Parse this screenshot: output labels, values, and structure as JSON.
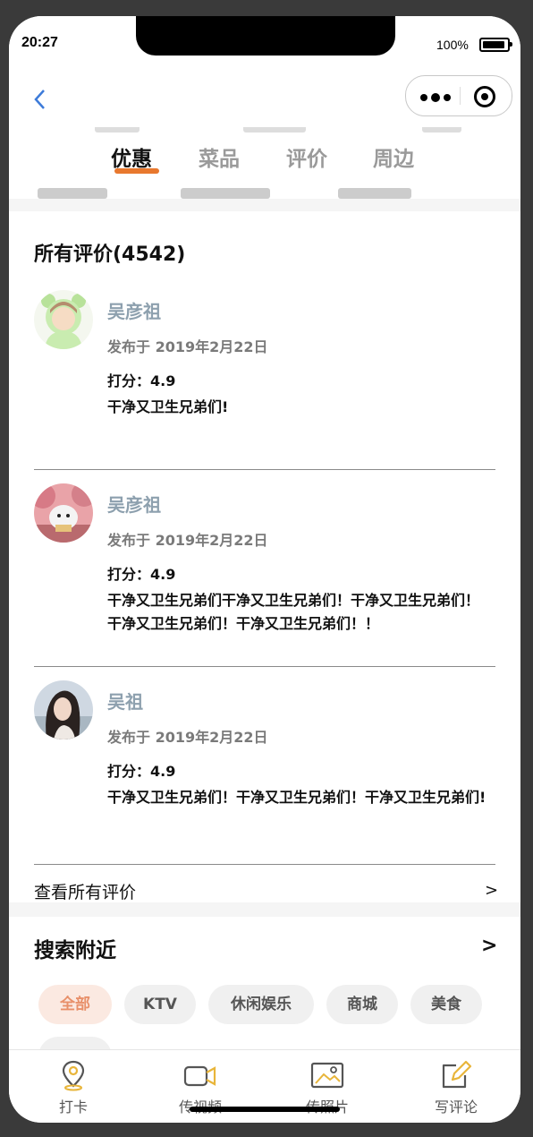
{
  "status_bar": {
    "time": "20:27",
    "battery": "100%"
  },
  "navbar": {
    "back_icon": "chevron-left-icon",
    "menu_icon": "more-dots-icon",
    "close_icon": "target-circle-icon"
  },
  "tabs": [
    {
      "label": "优惠",
      "active": true
    },
    {
      "label": "菜品",
      "active": false
    },
    {
      "label": "评价",
      "active": false
    },
    {
      "label": "周边",
      "active": false
    }
  ],
  "reviews": {
    "title": "所有评价(4542)",
    "items": [
      {
        "name": "吴彦祖",
        "date": "发布于 2019年2月22日",
        "score": "打分：4.9",
        "text": "干净又卫生兄弟们!"
      },
      {
        "name": "吴彦祖",
        "date": "发布于 2019年2月22日",
        "score": "打分：4.9",
        "text": "干净又卫生兄弟们干净又卫生兄弟们！干净又卫生兄弟们！干净又卫生兄弟们！干净又卫生兄弟们！！"
      },
      {
        "name": "吴祖",
        "date": "发布于 2019年2月22日",
        "score": "打分：4.9",
        "text": "干净又卫生兄弟们！干净又卫生兄弟们！干净又卫生兄弟们!"
      }
    ],
    "see_all": "查看所有评价",
    "see_all_arrow": ">"
  },
  "nearby": {
    "title": "搜索附近",
    "arrow": ">",
    "chips": [
      {
        "label": "全部",
        "active": true
      },
      {
        "label": "KTV",
        "active": false
      },
      {
        "label": "休闲娱乐",
        "active": false
      },
      {
        "label": "商城",
        "active": false
      },
      {
        "label": "美食",
        "active": false
      }
    ]
  },
  "bottom_bar": [
    {
      "label": "打卡",
      "icon": "location-pin-icon"
    },
    {
      "label": "传视频",
      "icon": "video-camera-icon"
    },
    {
      "label": "传照片",
      "icon": "photo-icon"
    },
    {
      "label": "写评论",
      "icon": "edit-pen-icon"
    }
  ],
  "colors": {
    "accent": "#e8782e",
    "link": "#3d7bd9",
    "reviewer_name": "#8da0ae",
    "chip_active_bg": "#fbe9e1"
  }
}
